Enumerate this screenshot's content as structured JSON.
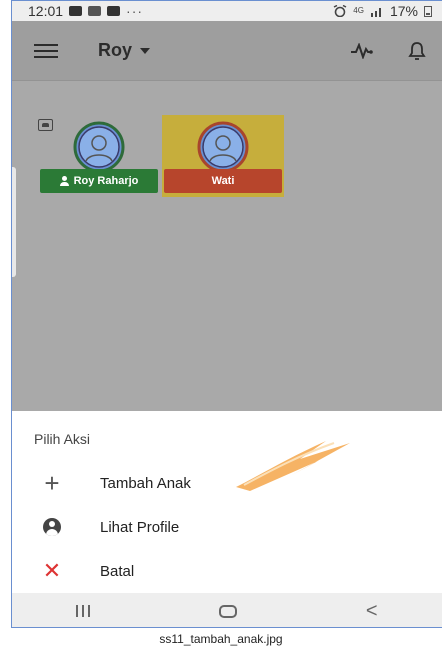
{
  "status_bar": {
    "time": "12:01",
    "network": "4G",
    "battery": "17%",
    "dots": "···"
  },
  "app_bar": {
    "user_name": "Roy",
    "icons": [
      "menu-icon",
      "activity-icon",
      "bell-icon"
    ]
  },
  "children": [
    {
      "name": "Roy Raharjo",
      "color": "#2b7a36",
      "selected": false
    },
    {
      "name": "Wati",
      "color": "#b7452c",
      "selected": true
    }
  ],
  "sheet": {
    "title": "Pilih Aksi",
    "items": [
      {
        "label": "Tambah Anak",
        "icon": "plus-icon"
      },
      {
        "label": "Lihat Profile",
        "icon": "account-circle-icon"
      },
      {
        "label": "Batal",
        "icon": "close-icon"
      }
    ]
  },
  "nav_bar": {
    "back_glyph": "<"
  },
  "caption": "ss11_tambah_anak.jpg",
  "colors": {
    "scrim": "#a9a9a9",
    "selected_card": "#c6ae3c",
    "cancel_icon": "#dd3333"
  }
}
